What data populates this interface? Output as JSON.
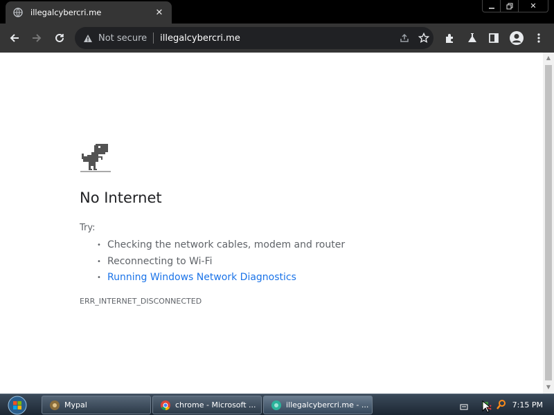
{
  "tab": {
    "title": "illegalcybercri.me",
    "favicon": "globe-icon"
  },
  "window_controls": {
    "minimize": "minimize-icon",
    "restore": "restore-icon",
    "close": "close-icon"
  },
  "toolbar": {
    "security_label": "Not secure",
    "url": "illegalcybercri.me",
    "icons": [
      "back-icon",
      "forward-icon",
      "reload-icon",
      "warning-icon",
      "share-icon",
      "star-icon",
      "extensions-icon",
      "labs-icon",
      "side-panel-icon",
      "profile-icon",
      "menu-icon"
    ]
  },
  "error_page": {
    "heading": "No Internet",
    "try_label": "Try:",
    "suggestions": [
      "Checking the network cables, modem and router",
      "Reconnecting to Wi-Fi",
      "Running Windows Network Diagnostics"
    ],
    "error_code": "ERR_INTERNET_DISCONNECTED"
  },
  "taskbar": {
    "tasks": [
      {
        "label": "Mypal"
      },
      {
        "label": "chrome - Microsoft ..."
      },
      {
        "label": "illegalcybercri.me - ..."
      }
    ],
    "clock": "7:15 PM"
  },
  "colors": {
    "link": "#1a73e8",
    "chrome_frame": "#353535",
    "omnibox": "#202124",
    "page_text": "#5f6368"
  }
}
